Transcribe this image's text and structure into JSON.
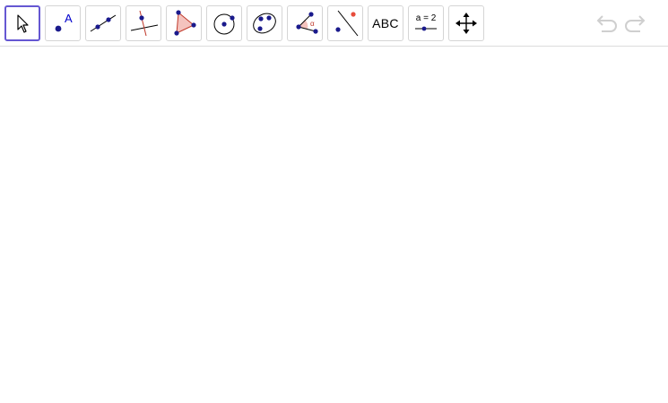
{
  "toolbar": {
    "tools": [
      {
        "name": "move-tool",
        "icon": "arrow-cursor-icon",
        "selected": true
      },
      {
        "name": "point-tool",
        "icon": "point-icon",
        "label": "A"
      },
      {
        "name": "line-tool",
        "icon": "line-through-points-icon"
      },
      {
        "name": "perpendicular-line-tool",
        "icon": "perpendicular-line-icon"
      },
      {
        "name": "polygon-tool",
        "icon": "polygon-icon"
      },
      {
        "name": "circle-tool",
        "icon": "circle-center-point-icon"
      },
      {
        "name": "conic-tool",
        "icon": "ellipse-icon"
      },
      {
        "name": "angle-tool",
        "icon": "angle-icon",
        "label": "α"
      },
      {
        "name": "reflect-tool",
        "icon": "reflect-about-line-icon"
      },
      {
        "name": "text-tool",
        "icon": "text-icon",
        "label": "ABC"
      },
      {
        "name": "slider-tool",
        "icon": "slider-icon",
        "label": "a = 2"
      },
      {
        "name": "move-graphics-view-tool",
        "icon": "move-arrows-icon"
      }
    ],
    "undo": {
      "icon": "undo-icon",
      "enabled": false
    },
    "redo": {
      "icon": "redo-icon",
      "enabled": false
    }
  },
  "colors": {
    "selected_border": "#6557d2",
    "point": "#1a1a8c",
    "label_blue": "#0000cc",
    "accent_red": "#c0392b",
    "polygon_fill": "#f4c3be",
    "disabled_icon": "#cfcfcf"
  }
}
